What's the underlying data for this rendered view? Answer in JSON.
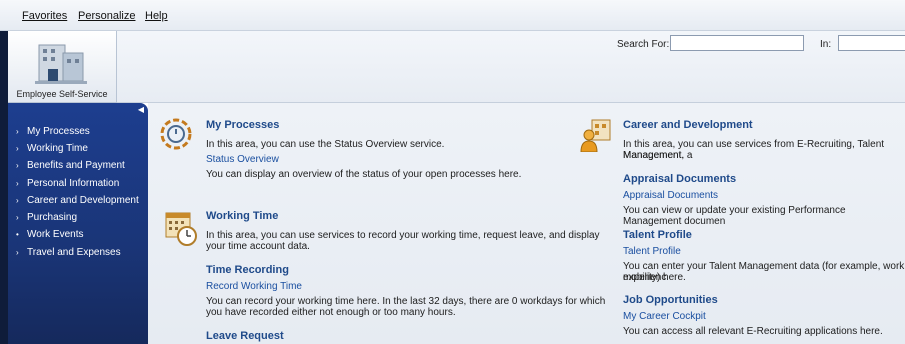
{
  "menu": {
    "favorites": "Favorites",
    "personalize": "Personalize",
    "help": "Help"
  },
  "search": {
    "search_for_label": "Search For:",
    "in_label": "In:"
  },
  "tile": {
    "label": "Employee Self-Service"
  },
  "sidebar": {
    "items": [
      {
        "label": "My Processes",
        "marker": "›"
      },
      {
        "label": "Working Time",
        "marker": "›"
      },
      {
        "label": "Benefits and Payment",
        "marker": "›"
      },
      {
        "label": "Personal Information",
        "marker": "›"
      },
      {
        "label": "Career and Development",
        "marker": "›"
      },
      {
        "label": "Purchasing",
        "marker": "›"
      },
      {
        "label": "Work Events",
        "marker": "•"
      },
      {
        "label": "Travel and Expenses",
        "marker": "›"
      }
    ]
  },
  "left_col": {
    "my_processes": {
      "title": "My Processes",
      "desc": "In this area, you can use the Status Overview service.",
      "link": "Status Overview",
      "link_desc": "You can display an overview of the status of your open processes here."
    },
    "working_time": {
      "title": "Working Time",
      "desc1": "In this area, you can use services to record your working time, request leave, and display",
      "desc2": "your time account data.",
      "time_recording": {
        "title": "Time Recording",
        "link": "Record Working Time",
        "text1": "You can record your working time here. In the last 32 days, there are 0 workdays for which",
        "text2": "you have recorded either not enough or too many hours."
      },
      "leave_request": {
        "title": "Leave Request"
      }
    }
  },
  "right_col": {
    "career": {
      "title": "Career and Development",
      "desc1": "In this area, you can use services from E-Recruiting, Talent Management, a",
      "desc2": "Management."
    },
    "appraisal": {
      "title": "Appraisal Documents",
      "link": "Appraisal Documents",
      "text": "You can view or update your existing Performance Management documen"
    },
    "talent": {
      "title": "Talent Profile",
      "link": "Talent Profile",
      "text1": "You can enter your Talent Management data (for example, work experienc",
      "text2": "mobility) here."
    },
    "jobs": {
      "title": "Job Opportunities",
      "link": "My Career Cockpit",
      "text": "You can access all relevant E-Recruiting applications here."
    }
  },
  "colors": {
    "sidebar": "#1d3e8f",
    "title": "#1f4a8a",
    "link": "#1a4fa0"
  }
}
